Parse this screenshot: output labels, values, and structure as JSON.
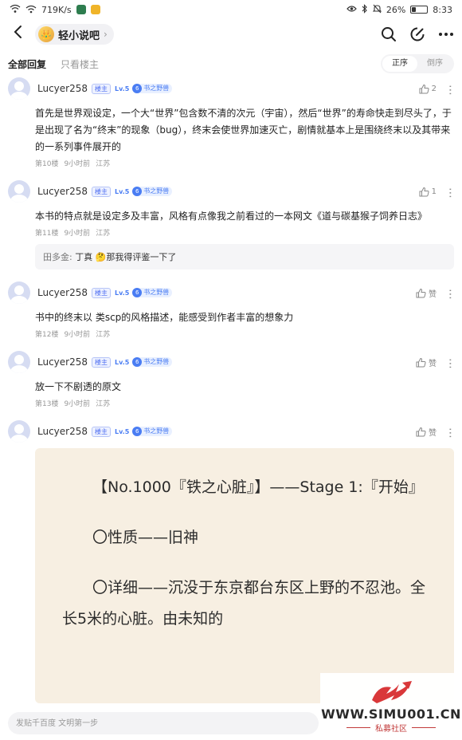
{
  "status_bar": {
    "net_speed": "719K/s",
    "battery": "26%",
    "battery_level": 0.26,
    "time": "8:33"
  },
  "header": {
    "forum_name": "轻小说吧",
    "forum_logo_text": "👑"
  },
  "tabs": {
    "all": "全部回复",
    "owner_only": "只看楼主"
  },
  "sort": {
    "asc": "正序",
    "desc": "倒序"
  },
  "posts": [
    {
      "username": "Lucyer258",
      "owner_badge": "楼主",
      "level": "Lv.5",
      "title_num": "6",
      "title": "书之野兽",
      "likes": "2",
      "body": "首先是世界观设定，一个大“世界”包含数不清的次元（宇宙），然后“世界”的寿命快走到尽头了，于是出现了名为“终末”的现象（bug），终末会使世界加速灭亡，剧情就基本上是围绕终末以及其带来的一系列事件展开的",
      "floor": "第10楼",
      "time": "9小时前",
      "location": "江苏"
    },
    {
      "username": "Lucyer258",
      "owner_badge": "楼主",
      "level": "Lv.5",
      "title_num": "6",
      "title": "书之野兽",
      "likes": "1",
      "body": "本书的特点就是设定多及丰富，风格有点像我之前看过的一本网文《道与碳基猴子饲养日志》",
      "floor": "第11楼",
      "time": "9小时前",
      "location": "江苏",
      "sub_reply": {
        "who": "田多金:",
        "text": " 丁真 🤔那我得评鉴一下了"
      }
    },
    {
      "username": "Lucyer258",
      "owner_badge": "楼主",
      "level": "Lv.5",
      "title_num": "6",
      "title": "书之野兽",
      "likes": "赞",
      "body": "书中的终末以 类scp的风格描述，能感受到作者丰富的想象力",
      "floor": "第12楼",
      "time": "9小时前",
      "location": "江苏"
    },
    {
      "username": "Lucyer258",
      "owner_badge": "楼主",
      "level": "Lv.5",
      "title_num": "6",
      "title": "书之野兽",
      "likes": "赞",
      "body": "放一下不剧透的原文",
      "floor": "第13楼",
      "time": "9小时前",
      "location": "江苏"
    },
    {
      "username": "Lucyer258",
      "owner_badge": "楼主",
      "level": "Lv.5",
      "title_num": "6",
      "title": "书之野兽",
      "likes": "赞"
    }
  ],
  "image_card": {
    "line1": "【No.1000『铁之心脏』】——Stage 1:『开始』",
    "line2": "〇性质——旧神",
    "line3": "〇详细——沉没于东京都台东区上野的不忍池。全长5米的心脏。由未知的"
  },
  "reply_input": {
    "placeholder": "发贴千百度 文明第一步"
  },
  "watermark": {
    "site": "WWW.SIMU001.CN",
    "sub": "私募社区"
  }
}
